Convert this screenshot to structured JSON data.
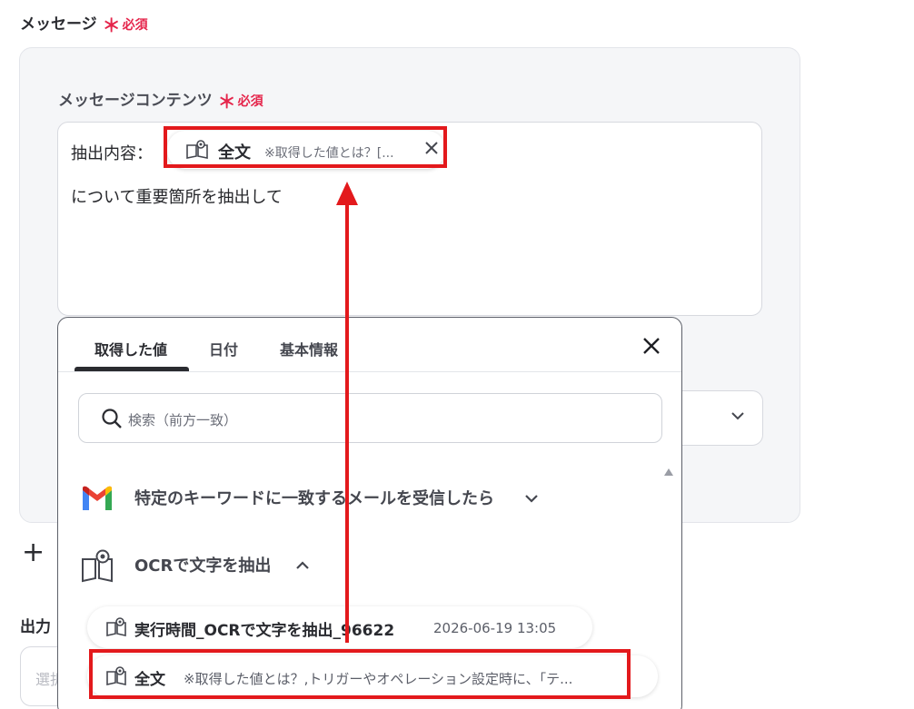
{
  "message_field": {
    "label": "メッセージ",
    "required": "必須",
    "required_mark": "＊"
  },
  "content_field": {
    "label": "メッセージコンテンツ",
    "required": "必須",
    "required_mark": "＊"
  },
  "textarea": {
    "prefix": "抽出内容：",
    "body": "について重要箇所を抽出して"
  },
  "chip": {
    "name": "全文",
    "desc": "※取得した値とは？[...",
    "icon": "ocr-book-icon"
  },
  "plus_label": "+",
  "output_field": {
    "label": "出力",
    "placeholder": "選択"
  },
  "popup": {
    "tabs": [
      {
        "label": "取得した値",
        "active": true
      },
      {
        "label": "日付"
      },
      {
        "label": "基本情報"
      }
    ],
    "search_placeholder": "検索（前方一致）",
    "groups": [
      {
        "name": "特定のキーワードに一致するメールを受信したら",
        "icon": "gmail-icon",
        "expanded": false
      },
      {
        "name": "OCRで文字を抽出",
        "icon": "ocr-book-icon",
        "expanded": true
      }
    ],
    "items": [
      {
        "name": "実行時間_OCRで文字を抽出_96622",
        "value": "2026-06-19 13:05"
      },
      {
        "name": "全文",
        "value": "※取得した値とは？,トリガーやオペレーション設定時に、「テ..."
      }
    ]
  },
  "colors": {
    "highlight": "#e3191c",
    "required": "#e5254b",
    "panel_bg": "#f5f6f8"
  }
}
